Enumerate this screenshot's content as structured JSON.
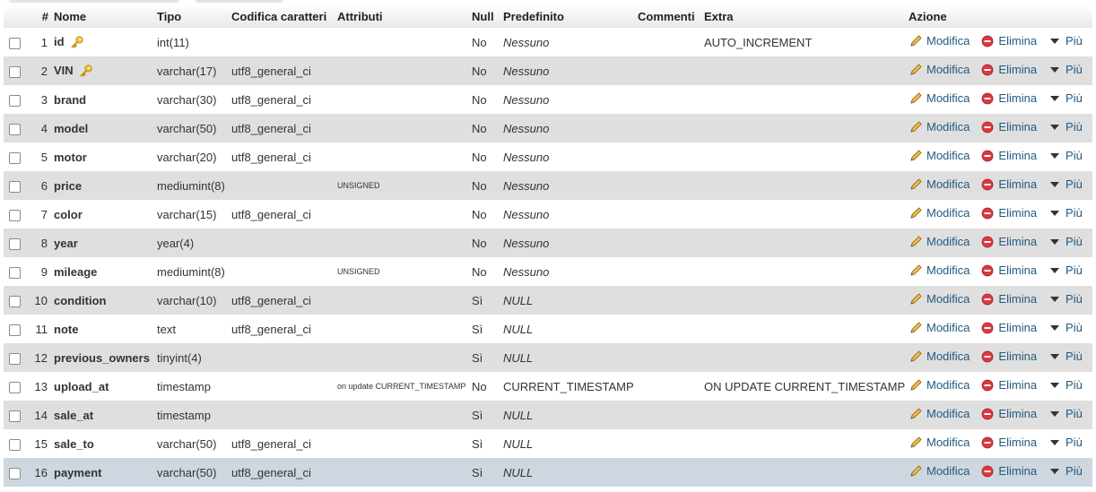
{
  "table": {
    "headers": {
      "num": "#",
      "name": "Nome",
      "type": "Tipo",
      "collation": "Codifica caratteri",
      "attributes": "Attributi",
      "null": "Null",
      "default": "Predefinito",
      "comments": "Commenti",
      "extra": "Extra",
      "action": "Azione"
    },
    "action_labels": {
      "edit": "Modifica",
      "delete": "Elimina",
      "more": "Più"
    },
    "icons": {
      "edit": "pencil-icon",
      "delete": "delete-icon",
      "more": "dropdown-arrow-icon",
      "primary": "key-icon"
    },
    "rows": [
      {
        "num": "1",
        "name": "id",
        "primary": true,
        "type": "int(11)",
        "collation": "",
        "attributes": "",
        "null": "No",
        "default": "Nessuno",
        "default_style": "italic",
        "comments": "",
        "extra": "AUTO_INCREMENT"
      },
      {
        "num": "2",
        "name": "VIN",
        "primary": true,
        "type": "varchar(17)",
        "collation": "utf8_general_ci",
        "attributes": "",
        "null": "No",
        "default": "Nessuno",
        "default_style": "italic",
        "comments": "",
        "extra": ""
      },
      {
        "num": "3",
        "name": "brand",
        "primary": false,
        "type": "varchar(30)",
        "collation": "utf8_general_ci",
        "attributes": "",
        "null": "No",
        "default": "Nessuno",
        "default_style": "italic",
        "comments": "",
        "extra": ""
      },
      {
        "num": "4",
        "name": "model",
        "primary": false,
        "type": "varchar(50)",
        "collation": "utf8_general_ci",
        "attributes": "",
        "null": "No",
        "default": "Nessuno",
        "default_style": "italic",
        "comments": "",
        "extra": ""
      },
      {
        "num": "5",
        "name": "motor",
        "primary": false,
        "type": "varchar(20)",
        "collation": "utf8_general_ci",
        "attributes": "",
        "null": "No",
        "default": "Nessuno",
        "default_style": "italic",
        "comments": "",
        "extra": ""
      },
      {
        "num": "6",
        "name": "price",
        "primary": false,
        "type": "mediumint(8)",
        "collation": "",
        "attributes": "UNSIGNED",
        "null": "No",
        "default": "Nessuno",
        "default_style": "italic",
        "comments": "",
        "extra": ""
      },
      {
        "num": "7",
        "name": "color",
        "primary": false,
        "type": "varchar(15)",
        "collation": "utf8_general_ci",
        "attributes": "",
        "null": "No",
        "default": "Nessuno",
        "default_style": "italic",
        "comments": "",
        "extra": ""
      },
      {
        "num": "8",
        "name": "year",
        "primary": false,
        "type": "year(4)",
        "collation": "",
        "attributes": "",
        "null": "No",
        "default": "Nessuno",
        "default_style": "italic",
        "comments": "",
        "extra": ""
      },
      {
        "num": "9",
        "name": "mileage",
        "primary": false,
        "type": "mediumint(8)",
        "collation": "",
        "attributes": "UNSIGNED",
        "null": "No",
        "default": "Nessuno",
        "default_style": "italic",
        "comments": "",
        "extra": ""
      },
      {
        "num": "10",
        "name": "condition",
        "primary": false,
        "type": "varchar(10)",
        "collation": "utf8_general_ci",
        "attributes": "",
        "null": "Sì",
        "default": "NULL",
        "default_style": "italic",
        "comments": "",
        "extra": ""
      },
      {
        "num": "11",
        "name": "note",
        "primary": false,
        "type": "text",
        "collation": "utf8_general_ci",
        "attributes": "",
        "null": "Sì",
        "default": "NULL",
        "default_style": "italic",
        "comments": "",
        "extra": ""
      },
      {
        "num": "12",
        "name": "previous_owners",
        "primary": false,
        "type": "tinyint(4)",
        "collation": "",
        "attributes": "",
        "null": "Sì",
        "default": "NULL",
        "default_style": "italic",
        "comments": "",
        "extra": ""
      },
      {
        "num": "13",
        "name": "upload_at",
        "primary": false,
        "type": "timestamp",
        "collation": "",
        "attributes": "on update CURRENT_TIMESTAMP",
        "null": "No",
        "default": "CURRENT_TIMESTAMP",
        "default_style": "plain",
        "comments": "",
        "extra": "ON UPDATE CURRENT_TIMESTAMP"
      },
      {
        "num": "14",
        "name": "sale_at",
        "primary": false,
        "type": "timestamp",
        "collation": "",
        "attributes": "",
        "null": "Sì",
        "default": "NULL",
        "default_style": "italic",
        "comments": "",
        "extra": ""
      },
      {
        "num": "15",
        "name": "sale_to",
        "primary": false,
        "type": "varchar(50)",
        "collation": "utf8_general_ci",
        "attributes": "",
        "null": "Sì",
        "default": "NULL",
        "default_style": "italic",
        "comments": "",
        "extra": ""
      },
      {
        "num": "16",
        "name": "payment",
        "primary": false,
        "type": "varchar(50)",
        "collation": "utf8_general_ci",
        "attributes": "",
        "null": "Sì",
        "default": "NULL",
        "default_style": "italic",
        "comments": "",
        "extra": "",
        "selected": true
      }
    ]
  },
  "colors": {
    "row_even": "#dfdfdf",
    "row_selected": "#ced6df",
    "link": "#235a81",
    "delete": "#d9393f"
  }
}
